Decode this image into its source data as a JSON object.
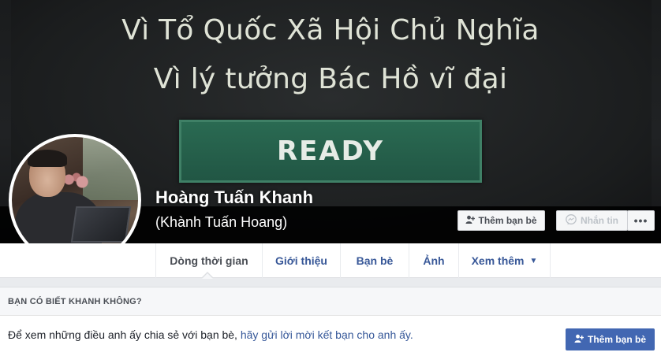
{
  "cover": {
    "line1": "Vì Tổ Quốc Xã Hội Chủ Nghĩa",
    "line2": "Vì lý tưởng Bác Hồ vĩ đại",
    "badge": "READY"
  },
  "profile": {
    "name": "Hoàng Tuấn Khanh",
    "alternate_name": "(Khành Tuấn Hoang)"
  },
  "actions": {
    "add_friend": "Thêm bạn bè",
    "message": "Nhắn tin",
    "more": "•••"
  },
  "tabs": [
    {
      "label": "Dòng thời gian"
    },
    {
      "label": "Giới thiệu"
    },
    {
      "label": "Bạn bè"
    },
    {
      "label": "Ảnh"
    },
    {
      "label": "Xem thêm"
    }
  ],
  "know": {
    "header": "BẠN CÓ BIẾT KHANH KHÔNG?",
    "body_text": "Để xem những điều anh ấy chia sẻ với bạn bè, ",
    "body_link": "hãy gửi lời mời kết bạn cho anh ấy.",
    "button": "Thêm bạn bè"
  },
  "colors": {
    "brand_blue": "#4267b2",
    "link_blue": "#385898",
    "background": "#e9ebee"
  },
  "icons": [
    "add-friend-icon",
    "messenger-icon",
    "more-dots-icon",
    "caret-down-icon"
  ]
}
